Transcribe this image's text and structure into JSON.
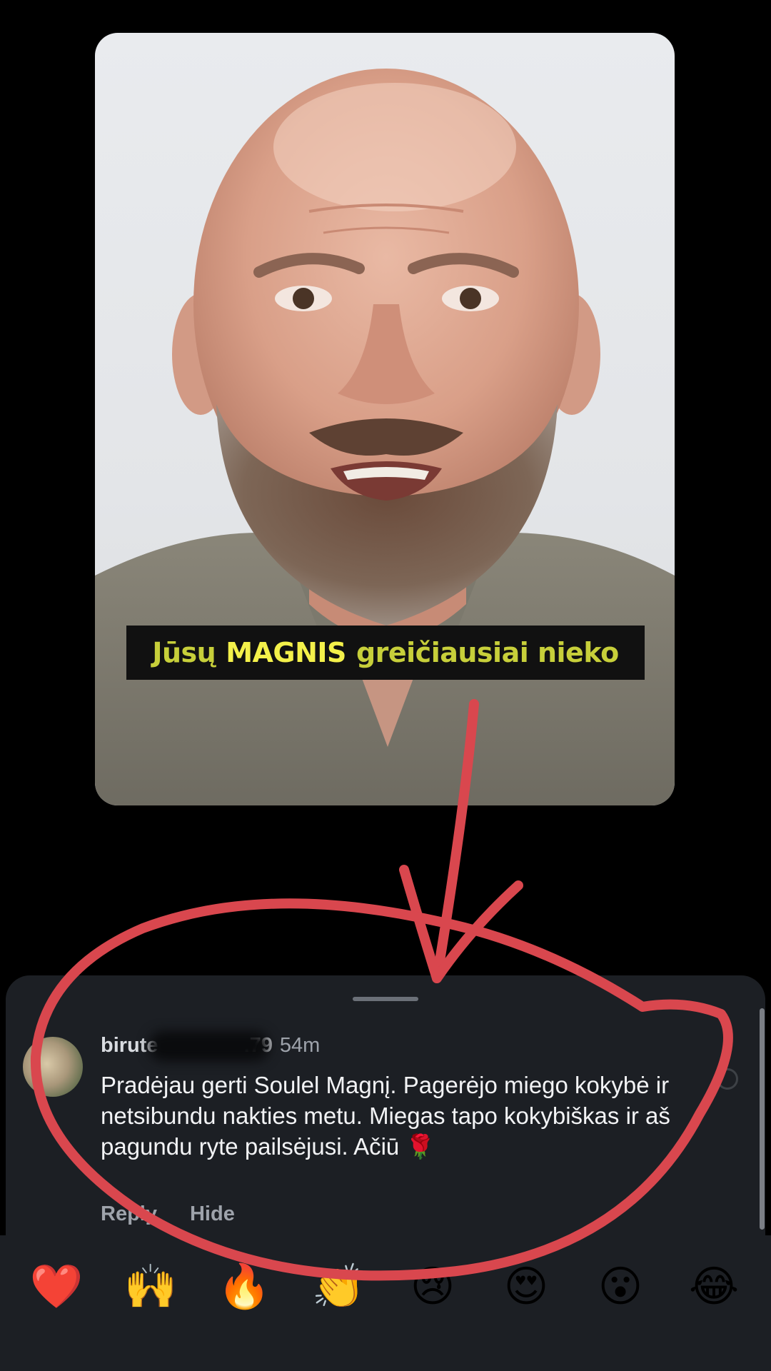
{
  "video": {
    "caption": {
      "word1": "Jūsų",
      "word2": "MAGNIS",
      "word3": "greičiausiai nieko"
    }
  },
  "comment": {
    "username": "birute",
    "username_tail": ".79",
    "time": "54m",
    "text": "Pradėjau gerti Soulel Magnį. Pagerėjo miego kokybė ir netsibundu nakties metu. Miegas tapo kokybiškas ir aš pagundu ryte pailsėjusi. Ačiū 🌹",
    "reply_label": "Reply",
    "hide_label": "Hide"
  },
  "reactions": [
    "❤️",
    "🙌",
    "🔥",
    "👏",
    "😢",
    "😍",
    "😮",
    "😂"
  ],
  "colors": {
    "annotation": "#d9474e",
    "sheet": "#1c1f24",
    "caption_yellow": "#f3f04a",
    "caption_olive": "#c7cf3a"
  }
}
